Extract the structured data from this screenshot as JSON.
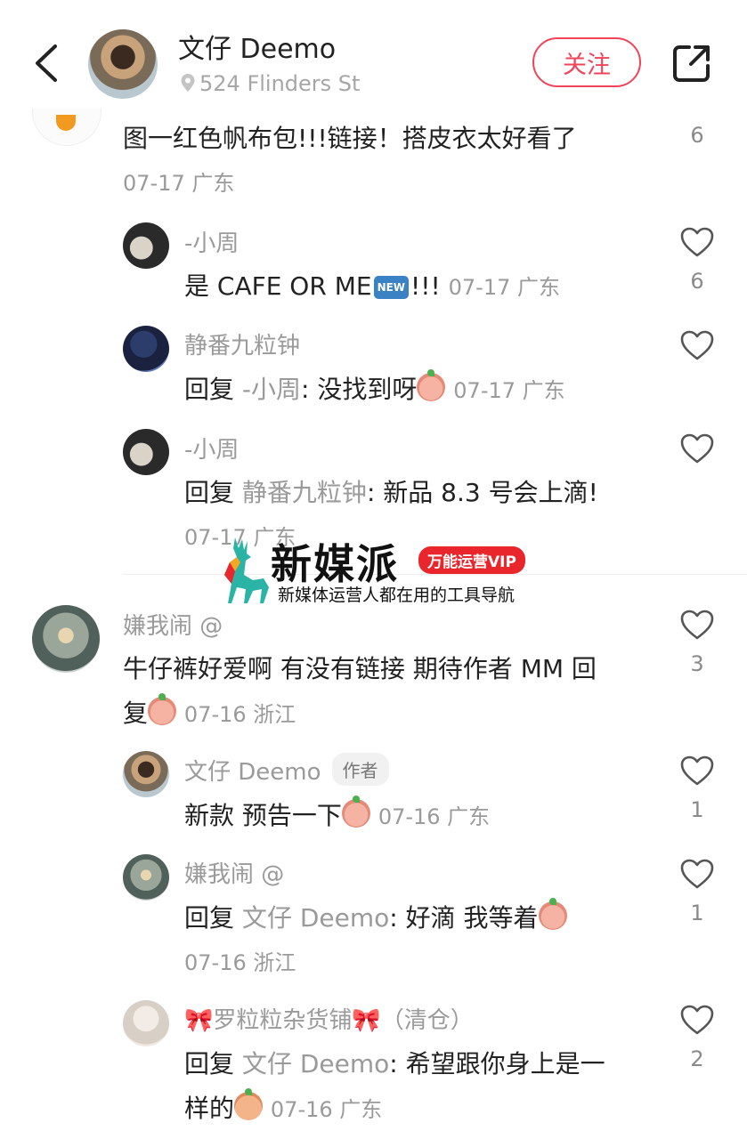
{
  "header": {
    "name": "文仔 Deemo",
    "location": "524 Flinders St",
    "follow_label": "关注"
  },
  "top_comment": {
    "text": "图一红色帆布包!!!链接！搭皮衣太好看了",
    "meta": "07-17 广东",
    "likes": "6"
  },
  "replies1": [
    {
      "name": "-小周",
      "text": "是 CAFE OR ME",
      "badge": "NEW",
      "after_badge": "!!!",
      "meta": "07-17 广东",
      "likes": "6"
    },
    {
      "name": "静番九粒钟",
      "reply_prefix": "回复",
      "reply_to": "-小周",
      "text": ": 没找到呀",
      "meta": "07-17 广东",
      "likes": ""
    },
    {
      "name": "-小周",
      "reply_prefix": "回复",
      "reply_to": "静番九粒钟",
      "text": ": 新品 8.3 号会上滴!",
      "meta": "07-17 广东",
      "likes": ""
    }
  ],
  "watermark": {
    "title": "新媒派",
    "badge": "万能运营VIP",
    "subtitle": "新媒体运营人都在用的工具导航"
  },
  "comment2": {
    "name": "嫌我闹 @",
    "text_line1": "牛仔裤好爱啊 有没有链接 期待作者 MM 回",
    "text_line2": "复",
    "meta": "07-16 浙江",
    "likes": "3"
  },
  "replies2": [
    {
      "name": "文仔 Deemo",
      "tag": "作者",
      "text": "新款 预告一下",
      "meta": "07-16 广东",
      "likes": "1"
    },
    {
      "name": "嫌我闹 @",
      "reply_prefix": "回复",
      "reply_to": "文仔 Deemo",
      "text": ": 好滴 我等着",
      "meta": "07-16 浙江",
      "likes": "1"
    },
    {
      "name": "🎀罗粒粒杂货铺🎀（清仓）",
      "reply_prefix": "回复",
      "reply_to": "文仔 Deemo",
      "text": ": 希望跟你身上是一",
      "text2": "样的",
      "meta": "07-16 广东",
      "likes": "2"
    }
  ],
  "colors": {
    "accent": "#f0445a",
    "muted": "#9a9a9a",
    "text": "#222222"
  }
}
